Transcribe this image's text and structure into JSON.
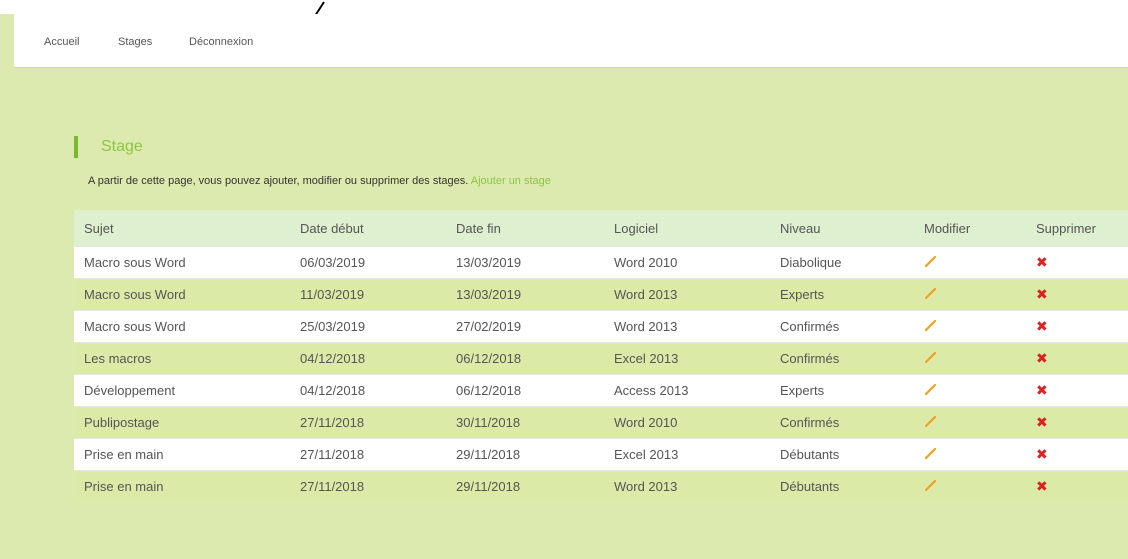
{
  "nav": {
    "items": [
      {
        "label": "Accueil"
      },
      {
        "label": "Stages"
      },
      {
        "label": "Déconnexion"
      }
    ]
  },
  "section": {
    "title": "Stage",
    "intro_text": "A partir de cette page, vous pouvez ajouter, modifier ou supprimer des stages.",
    "add_link": "Ajouter un stage"
  },
  "table": {
    "headers": [
      "Sujet",
      "Date début",
      "Date fin",
      "Logiciel",
      "Niveau",
      "Modifier",
      "Supprimer"
    ],
    "rows": [
      [
        "Macro sous Word",
        "06/03/2019",
        "13/03/2019",
        "Word 2010",
        "Diabolique"
      ],
      [
        "Macro sous Word",
        "11/03/2019",
        "13/03/2019",
        "Word 2013",
        "Experts"
      ],
      [
        "Macro sous Word",
        "25/03/2019",
        "27/02/2019",
        "Word 2013",
        "Confirmés"
      ],
      [
        "Les macros",
        "04/12/2018",
        "06/12/2018",
        "Excel 2013",
        "Confirmés"
      ],
      [
        "Développement",
        "04/12/2018",
        "06/12/2018",
        "Access 2013",
        "Experts"
      ],
      [
        "Publipostage",
        "27/11/2018",
        "30/11/2018",
        "Word 2010",
        "Confirmés"
      ],
      [
        "Prise en main",
        "27/11/2018",
        "29/11/2018",
        "Excel 2013",
        "Débutants"
      ],
      [
        "Prise en main",
        "27/11/2018",
        "29/11/2018",
        "Word 2013",
        "Débutants"
      ]
    ],
    "edit_icon": "pencil-icon",
    "delete_icon": "cross-icon"
  },
  "colors": {
    "background": "#ddeaaf",
    "accent": "#8cc63f",
    "delete": "#e02020",
    "edit": "#f0a020"
  }
}
